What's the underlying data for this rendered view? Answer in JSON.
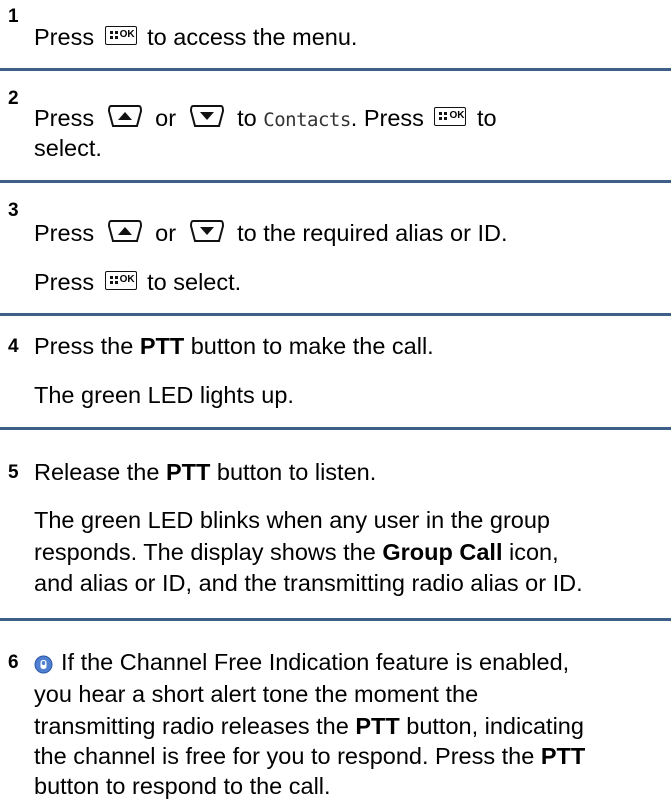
{
  "steps": [
    {
      "number": "1",
      "lines": [
        {
          "a": "Press",
          "b": "to access the menu."
        }
      ]
    },
    {
      "number": "2",
      "lines": [
        {
          "a": "Press",
          "or": "or",
          "to": "to",
          "menu_item": "Contacts",
          "b": ". Press",
          "c": "to"
        },
        {
          "a": "select."
        }
      ]
    },
    {
      "number": "3",
      "lines": [
        {
          "a": "Press",
          "or": "or",
          "b": "to the required alias or ID."
        },
        {
          "a": "Press",
          "b": "to select."
        }
      ]
    },
    {
      "number": "4",
      "lines": [
        {
          "a": "Press the",
          "bold": "PTT",
          "b": "button to make the call."
        },
        {
          "a": "The green LED lights up."
        }
      ]
    },
    {
      "number": "5",
      "lines": [
        {
          "a": "Release the",
          "bold": "PTT",
          "b": "button to listen."
        },
        {
          "a": "The green LED blinks when any user in the group"
        },
        {
          "a": "responds. The display shows the",
          "bold": "Group Call",
          "b": "icon,"
        },
        {
          "a": "and alias or ID, and the transmitting radio alias or ID."
        }
      ]
    },
    {
      "number": "6",
      "lines": [
        {
          "a": "If the Channel Free Indication feature is enabled,"
        },
        {
          "a": "you hear a short alert tone the moment the"
        },
        {
          "a": "transmitting radio releases the",
          "bold": "PTT",
          "b": "button, indicating"
        },
        {
          "a": "the channel is free for you to respond. Press the",
          "bold": "PTT"
        },
        {
          "a": "button to respond to the call."
        }
      ]
    }
  ],
  "keys": {
    "ok_label": "OK"
  },
  "icons": {
    "menu_ok": "menu-ok-key-icon",
    "up": "up-arrow-key-icon",
    "down": "down-arrow-key-icon",
    "note": "note-icon"
  },
  "colors": {
    "rule": "#3e5f87",
    "note_icon": "#4f7fd1"
  }
}
